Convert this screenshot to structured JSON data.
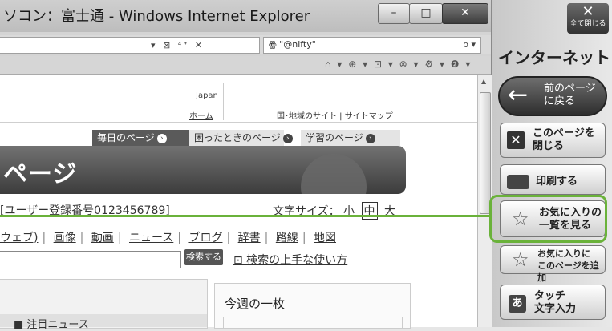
{
  "browser": {
    "title": "ソコン：富士通 - Windows Internet Explorer",
    "min_glyph": "–",
    "max_glyph": "□",
    "close_glyph": "✕",
    "address_icons": "▾ ⊠ ⁴ᐩ ✕",
    "search_text": "ꙮ \"@nifty\"",
    "search_go": "ρ ▾",
    "cmd_icons": "⌂ ▾ ⊕ ▾ ⊡ ▾ ⊗ ▾ ⚙ ▾ ❷ ▾"
  },
  "page": {
    "japan": "Japan",
    "home": "ホーム",
    "country_links": "国･地域のサイト | サイトマップ",
    "tabs": [
      {
        "label": "毎日のページ"
      },
      {
        "label": "困ったときのページ"
      },
      {
        "label": "学習のページ"
      }
    ],
    "tab_arrow": "›",
    "banner_title": "ページ",
    "user_line": "[ユーザー登録番号0123456789]",
    "font_size_label": "文字サイズ：",
    "font_small": "小",
    "font_mid": "中",
    "font_large": "大",
    "nav_links": [
      "ウェブ)",
      "画像",
      "動画",
      "ニュース",
      "ブログ",
      "辞書",
      "路線",
      "地図"
    ],
    "nav_sep": "|",
    "search_button": "検索する",
    "search_help": "⊡ 検索の上手な使い方",
    "news_title": "■ 注目ニュース",
    "week_title": "今週の一枚"
  },
  "panel": {
    "close_all_x": "✕",
    "close_all_label": "全て閉じる",
    "title": "インターネット",
    "back_arrow": "←",
    "back_label": "前のページ\nに戻る",
    "close_page_label": "このページを\n閉じる",
    "print_label": "印刷する",
    "favorites_label": "お気に入りの\n一覧を見る",
    "add_fav_label": "お気に入りに\nこのページを追加",
    "touch_label": "タッチ\n文字入力",
    "xbox": "✕",
    "abox": "あ",
    "star": "☆"
  },
  "colors": {
    "highlight": "#6ab23a"
  }
}
